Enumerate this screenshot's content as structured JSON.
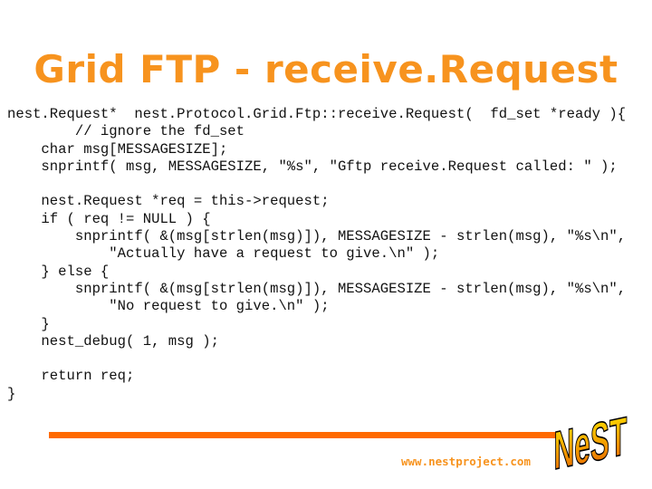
{
  "slide": {
    "title": "Grid FTP - receive.Request",
    "code_lines": [
      "nest.Request*  nest.Protocol.Grid.Ftp::receive.Request(  fd_set *ready ){",
      "        // ignore the fd_set",
      "    char msg[MESSAGESIZE];",
      "    snprintf( msg, MESSAGESIZE, \"%s\", \"Gftp receive.Request called: \" );",
      "",
      "    nest.Request *req = this->request;",
      "    if ( req != NULL ) {",
      "        snprintf( &(msg[strlen(msg)]), MESSAGESIZE - strlen(msg), \"%s\\n\",",
      "            \"Actually have a request to give.\\n\" );",
      "    } else {",
      "        snprintf( &(msg[strlen(msg)]), MESSAGESIZE - strlen(msg), \"%s\\n\",",
      "            \"No request to give.\\n\" );",
      "    }",
      "    nest_debug( 1, msg );",
      "",
      "    return req;",
      "}"
    ],
    "footer": {
      "url": "www.nestproject.com",
      "logo_text": "NeST",
      "logo_icon": "nest-logo-icon"
    },
    "colors": {
      "title": "#F7931E",
      "rule": "#FF6A00",
      "logo_top": "#FFE600",
      "logo_bottom": "#E65C00"
    }
  }
}
